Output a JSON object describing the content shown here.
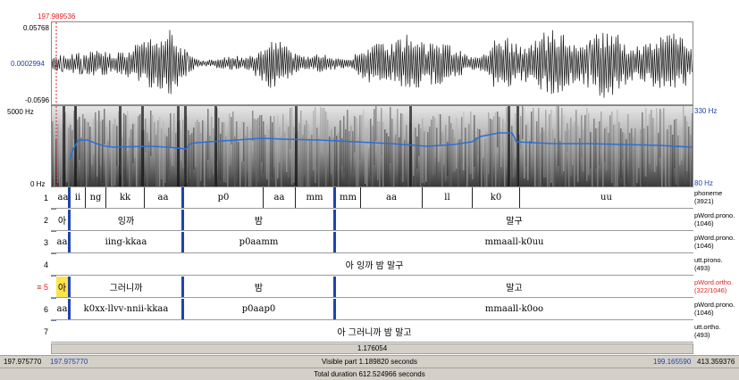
{
  "cursor_time": "197.989536",
  "waveform": {
    "max": "0.05768",
    "mid": "0.0002994",
    "min": "-0.0596"
  },
  "spectrogram": {
    "top_freq": "5000 Hz",
    "bottom_freq": "0 Hz",
    "pitch_top": "330 Hz",
    "pitch_bottom": "80 Hz"
  },
  "tiers": [
    {
      "num": "1",
      "name": "phoneme",
      "count": "(3921)",
      "segs": [
        "aa",
        "ii",
        "ng",
        "kk",
        "aa",
        "p0",
        "aa",
        "mm",
        "mm",
        "aa",
        "ll",
        "k0",
        "uu"
      ]
    },
    {
      "num": "2",
      "name": "pWord.prono.",
      "count": "(1046)",
      "segs": [
        "아",
        "잉까",
        "밤",
        "말구"
      ]
    },
    {
      "num": "3",
      "name": "pWord.prono.",
      "count": "(1046)",
      "segs": [
        "aa",
        "iing-kkaa",
        "p0aamm",
        "mmaall-k0uu"
      ]
    },
    {
      "num": "4",
      "name": "utt.prono.",
      "count": "(493)",
      "segs": [
        "아 잉까 밤 말구"
      ]
    },
    {
      "num": "≡ 5",
      "name": "pWord.ortho.",
      "count": "(322/1046)",
      "segs": [
        "아",
        "그러니까",
        "밤",
        "말고"
      ]
    },
    {
      "num": "6",
      "name": "pWord.prono.",
      "count": "(1046)",
      "segs": [
        "aa",
        "k0xx-llvv-nnii-kkaa",
        "p0aap0",
        "mmaall-k0oo"
      ]
    },
    {
      "num": "7",
      "name": "utt.ortho.",
      "count": "(493)",
      "segs": [
        "아 그러니까 밤 말고"
      ]
    }
  ],
  "selection_duration": "1.176054",
  "window_start": "197.975770",
  "window_start_blue": "197.975770",
  "visible_part": "Visible part 1.189820 seconds",
  "window_end_blue": "199.165590",
  "window_end": "413.359376",
  "total_duration": "Total duration 612.524966 seconds",
  "colors": {
    "pitch": "#2d6fd6",
    "boundary": "#1f43b0",
    "cursor": "#e02020",
    "highlight": "#ffe34d"
  }
}
